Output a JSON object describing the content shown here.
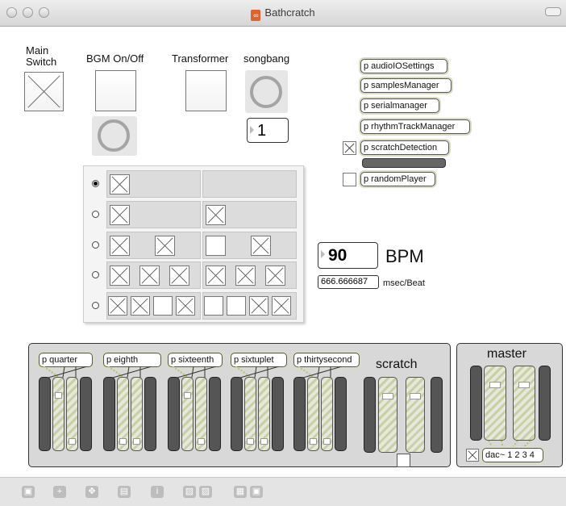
{
  "window": {
    "title": "Bathcratch",
    "app_icon": "max-patch-icon"
  },
  "toggles_top": {
    "main_switch_label": "Main\nSwitch",
    "bgm_label": "BGM On/Off",
    "transformer_label": "Transformer",
    "songbang_label": "songbang",
    "songbang_value": "1"
  },
  "subpatchers": {
    "audio": "p audioIOSettings",
    "samples": "p samplesManager",
    "serial": "p serialmanager",
    "rhythm": "p rhythmTrackManager",
    "scratch": "p scratchDetection",
    "random": "p randomPlayer"
  },
  "grid": {
    "rows": [
      {
        "selected": true,
        "left": [
          "x"
        ],
        "right": []
      },
      {
        "selected": false,
        "left": [
          "x"
        ],
        "right": [
          "x"
        ]
      },
      {
        "selected": false,
        "left": [
          "x",
          "x"
        ],
        "right": [
          "o",
          "x"
        ]
      },
      {
        "selected": false,
        "left": [
          "x",
          "x",
          "x"
        ],
        "right": [
          "x",
          "x",
          "x"
        ]
      },
      {
        "selected": false,
        "left": [
          "x",
          "x",
          "o",
          "x"
        ],
        "right": [
          "o",
          "o",
          "x",
          "x"
        ]
      }
    ]
  },
  "tempo": {
    "bpm_value": "90",
    "bpm_label": "BPM",
    "msec_value": "666.666687",
    "msec_label": "msec/Beat"
  },
  "mixer": {
    "channels": [
      "p quarter",
      "p eighth",
      "p sixteenth",
      "p sixtuplet",
      "p thirtysecond"
    ],
    "channel_levels": [
      0.78,
      0.08,
      0.08,
      0.08,
      0.78,
      0.08,
      0.08,
      0.08,
      0.08,
      0.08
    ],
    "scratch_label": "scratch",
    "scratch_levels": [
      0.92,
      0.92
    ],
    "master_label": "master",
    "master_levels": [
      0.9,
      0.9
    ],
    "dac_label": "dac~ 1 2 3 4"
  },
  "toolbar": {
    "icons": [
      "lock-icon",
      "plus-icon",
      "move-icon",
      "inspector-icon",
      "info-icon",
      "copy-icon",
      "paste-icon",
      "grid-icon",
      "snap-icon"
    ]
  },
  "colors": {
    "accent_slider": "#c8d0a4",
    "panel_bg": "#d8d8d8",
    "title_icon": "#e0622f"
  }
}
